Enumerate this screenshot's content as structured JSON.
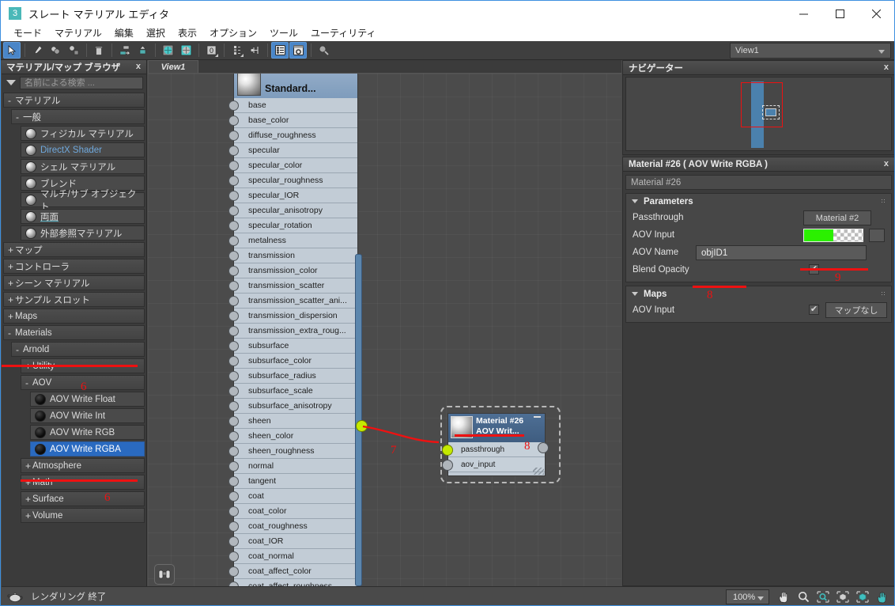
{
  "window": {
    "title": "スレート マテリアル エディタ",
    "app_badge": "3",
    "minimize_label": "最小化",
    "maximize_label": "最大化",
    "close_label": "閉じる"
  },
  "menubar": {
    "items": [
      {
        "label": "モード"
      },
      {
        "label": "マテリアル"
      },
      {
        "label": "編集"
      },
      {
        "label": "選択"
      },
      {
        "label": "表示"
      },
      {
        "label": "オプション"
      },
      {
        "label": "ツール"
      },
      {
        "label": "ユーティリティ"
      }
    ]
  },
  "toolbar": {
    "buttons": [
      {
        "name": "select-tool",
        "icon": "cursor-arrow-icon",
        "active": true
      },
      {
        "name": "pick-material-tool",
        "icon": "eyedropper-icon",
        "active": false
      },
      {
        "name": "assign-material-tool",
        "icon": "assign-material-icon",
        "active": false
      },
      {
        "name": "show-in-viewport-tool",
        "icon": "material-to-object-icon",
        "active": false
      },
      {
        "name": "delete-node-tool",
        "icon": "trash-icon",
        "active": false
      },
      {
        "name": "move-children-tool",
        "icon": "move-children-icon",
        "active": false
      },
      {
        "name": "layout-all-tool",
        "icon": "layout-all-icon",
        "active": false
      },
      {
        "name": "show-background-tool",
        "icon": "checker-background-icon",
        "active": false
      },
      {
        "name": "backlight-tool",
        "icon": "checker-teal-icon",
        "active": false
      },
      {
        "name": "material-id-channel-tool",
        "icon": "zero-channel-icon",
        "active": false
      },
      {
        "name": "show-end-result-tool",
        "icon": "end-result-icon",
        "active": false
      },
      {
        "name": "go-to-parent-tool",
        "icon": "go-to-parent-icon",
        "active": false
      },
      {
        "name": "toggle-browser-tool",
        "icon": "browser-panel-icon",
        "active": true
      },
      {
        "name": "toggle-parameter-editor-tool",
        "icon": "parameter-editor-icon",
        "active": true
      },
      {
        "name": "lay-out-children-tool",
        "icon": "magnifier-material-icon",
        "active": false
      }
    ],
    "view_select": {
      "value": "View1"
    }
  },
  "browser": {
    "title": "マテリアル/マップ ブラウザ",
    "close_label": "x",
    "search_placeholder": "名前による検索 ...",
    "tree": [
      {
        "label": "マテリアル",
        "state": "-",
        "indent": 0,
        "kind": "group"
      },
      {
        "label": "一般",
        "state": "-",
        "indent": 1,
        "kind": "group"
      },
      {
        "label": "フィジカル マテリアル",
        "indent": 2,
        "kind": "sphere"
      },
      {
        "label": "DirectX Shader",
        "indent": 2,
        "kind": "sphere",
        "style": "link"
      },
      {
        "label": "シェル マテリアル",
        "indent": 2,
        "kind": "sphere"
      },
      {
        "label": "ブレンド",
        "indent": 2,
        "kind": "sphere"
      },
      {
        "label": "マルチ/サブ オブジェクト",
        "indent": 2,
        "kind": "sphere"
      },
      {
        "label": "両面",
        "indent": 2,
        "kind": "sphere"
      },
      {
        "label": "外部参照マテリアル",
        "indent": 2,
        "kind": "sphere"
      },
      {
        "label": "マップ",
        "state": "+",
        "indent": 0,
        "kind": "group"
      },
      {
        "label": "コントローラ",
        "state": "+",
        "indent": 0,
        "kind": "group"
      },
      {
        "label": "シーン マテリアル",
        "state": "+",
        "indent": 0,
        "kind": "group"
      },
      {
        "label": "サンプル スロット",
        "state": "+",
        "indent": 0,
        "kind": "group"
      },
      {
        "label": "Maps",
        "state": "+",
        "indent": 0,
        "kind": "group"
      },
      {
        "label": "Materials",
        "state": "-",
        "indent": 0,
        "kind": "group"
      },
      {
        "label": "Arnold",
        "state": "-",
        "indent": 1,
        "kind": "group"
      },
      {
        "label": "Utility",
        "state": "+",
        "indent": 2,
        "kind": "group"
      },
      {
        "label": "AOV",
        "state": "-",
        "indent": 2,
        "kind": "group"
      },
      {
        "label": "AOV Write Float",
        "indent": 3,
        "kind": "black"
      },
      {
        "label": "AOV Write Int",
        "indent": 3,
        "kind": "black"
      },
      {
        "label": "AOV Write RGB",
        "indent": 3,
        "kind": "black"
      },
      {
        "label": "AOV Write RGBA",
        "indent": 3,
        "kind": "black",
        "selected": true
      },
      {
        "label": "Atmosphere",
        "state": "+",
        "indent": 2,
        "kind": "group"
      },
      {
        "label": "Math",
        "state": "+",
        "indent": 2,
        "kind": "group"
      },
      {
        "label": "Surface",
        "state": "+",
        "indent": 2,
        "kind": "group"
      },
      {
        "label": "Volume",
        "state": "+",
        "indent": 2,
        "kind": "group"
      }
    ]
  },
  "center": {
    "tab_label": "View1",
    "standard_node": {
      "title": "Standard...",
      "sockets": [
        "base",
        "base_color",
        "diffuse_roughness",
        "specular",
        "specular_color",
        "specular_roughness",
        "specular_IOR",
        "specular_anisotropy",
        "specular_rotation",
        "metalness",
        "transmission",
        "transmission_color",
        "transmission_scatter",
        "transmission_scatter_ani...",
        "transmission_dispersion",
        "transmission_extra_roug...",
        "subsurface",
        "subsurface_color",
        "subsurface_radius",
        "subsurface_scale",
        "subsurface_anisotropy",
        "sheen",
        "sheen_color",
        "sheen_roughness",
        "normal",
        "tangent",
        "coat",
        "coat_color",
        "coat_roughness",
        "coat_IOR",
        "coat_normal",
        "coat_affect_color",
        "coat_affect_roughness"
      ]
    },
    "material_node": {
      "title_line1": "Material #26",
      "title_line2": "AOV  Writ...",
      "sockets": [
        "passthrough",
        "aov_input"
      ]
    },
    "zoom_extents_icon": "binoculars-icon"
  },
  "navigator": {
    "title": "ナビゲーター",
    "close_label": "x"
  },
  "properties": {
    "title": "Material #26  ( AOV Write RGBA )",
    "close_label": "x",
    "name_value": "Material #26",
    "rollouts": [
      {
        "title": "Parameters",
        "rows": [
          {
            "label": "Passthrough",
            "control": "button",
            "value": "Material #2"
          },
          {
            "label": "AOV Input",
            "control": "color-swatch",
            "value": "#2bf000"
          },
          {
            "label": "AOV Name",
            "control": "text",
            "value": "objID1"
          },
          {
            "label": "Blend Opacity",
            "control": "checkbox",
            "checked": true
          }
        ]
      },
      {
        "title": "Maps",
        "rows": [
          {
            "label": "AOV Input",
            "control": "map-button",
            "checked": true,
            "value": "マップなし"
          }
        ]
      }
    ]
  },
  "annotations": {
    "numbers": [
      "6",
      "6",
      "7",
      "8",
      "8",
      "9"
    ]
  },
  "statusbar": {
    "icon": "teapot-icon",
    "text": "レンダリング 終了",
    "zoom_value": "100%",
    "tools": [
      {
        "name": "pan-tool",
        "icon": "hand-icon"
      },
      {
        "name": "zoom-tool",
        "icon": "magnifier-icon"
      },
      {
        "name": "zoom-region-tool",
        "icon": "zoom-region-icon"
      },
      {
        "name": "zoom-extents-selected-tool",
        "icon": "zoom-extents-selected-icon"
      },
      {
        "name": "zoom-extents-tool",
        "icon": "zoom-extents-icon"
      },
      {
        "name": "pan-view-tool",
        "icon": "pan-view-icon"
      }
    ]
  }
}
